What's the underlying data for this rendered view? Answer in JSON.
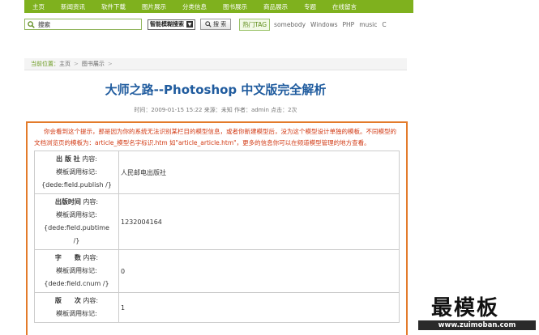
{
  "nav": {
    "items": [
      "主页",
      "新闻资讯",
      "软件下载",
      "图片展示",
      "分类信息",
      "图书展示",
      "商品展示",
      "专题",
      "在线留言"
    ]
  },
  "search": {
    "placeholder": "搜索",
    "mode": "智能模糊搜索",
    "button_label": "搜 索",
    "tags_label": "热门TAG",
    "tags": [
      "somebody",
      "Windows",
      "PHP",
      "music",
      "C"
    ]
  },
  "breadcrumb": {
    "label": "当前位置：",
    "items": [
      "主页",
      "图书展示"
    ]
  },
  "article": {
    "title": "大师之路--Photoshop 中文版完全解析",
    "meta": "时间：2009-01-15 15:22 来源：未知 作者：admin 点击：2次"
  },
  "notice": "你会看到这个提示，那是因为你的系统无法识别某栏目的模型信息，或者你新建模型后，没为这个模型设计单独的模板。不同模型的文档浏览页的模板为：article_模型名字标识.htm 如\"article_article.htm\"，更多的信息你可以在频道模型管理的地方查看。",
  "fields": [
    {
      "name": "出 版 社",
      "content_label": "内容:",
      "tag_label": "模板调用标记:",
      "tag_line1": "{dede:field.publish /}",
      "tag_line2": "",
      "value": "人民邮电出版社"
    },
    {
      "name": "出版时间",
      "content_label": "内容:",
      "tag_label": "模板调用标记:",
      "tag_line1": "{dede:field.pubtime",
      "tag_line2": "/}",
      "value": "1232004164"
    },
    {
      "name": "字　　数",
      "content_label": "内容:",
      "tag_label": "模板调用标记:",
      "tag_line1": "{dede:field.cnum /}",
      "tag_line2": "",
      "value": "0"
    },
    {
      "name": "版　　次",
      "content_label": "内容:",
      "tag_label": "模板调用标记:",
      "tag_line1": "",
      "tag_line2": "",
      "value": "1"
    }
  ],
  "watermark": {
    "title": "最模板",
    "url": "www.zuimoban.com"
  },
  "colors": {
    "nav_bg": "#7fb11e",
    "title": "#1f5b9e",
    "notice": "#d23a14",
    "content_border": "#e37b2b"
  }
}
